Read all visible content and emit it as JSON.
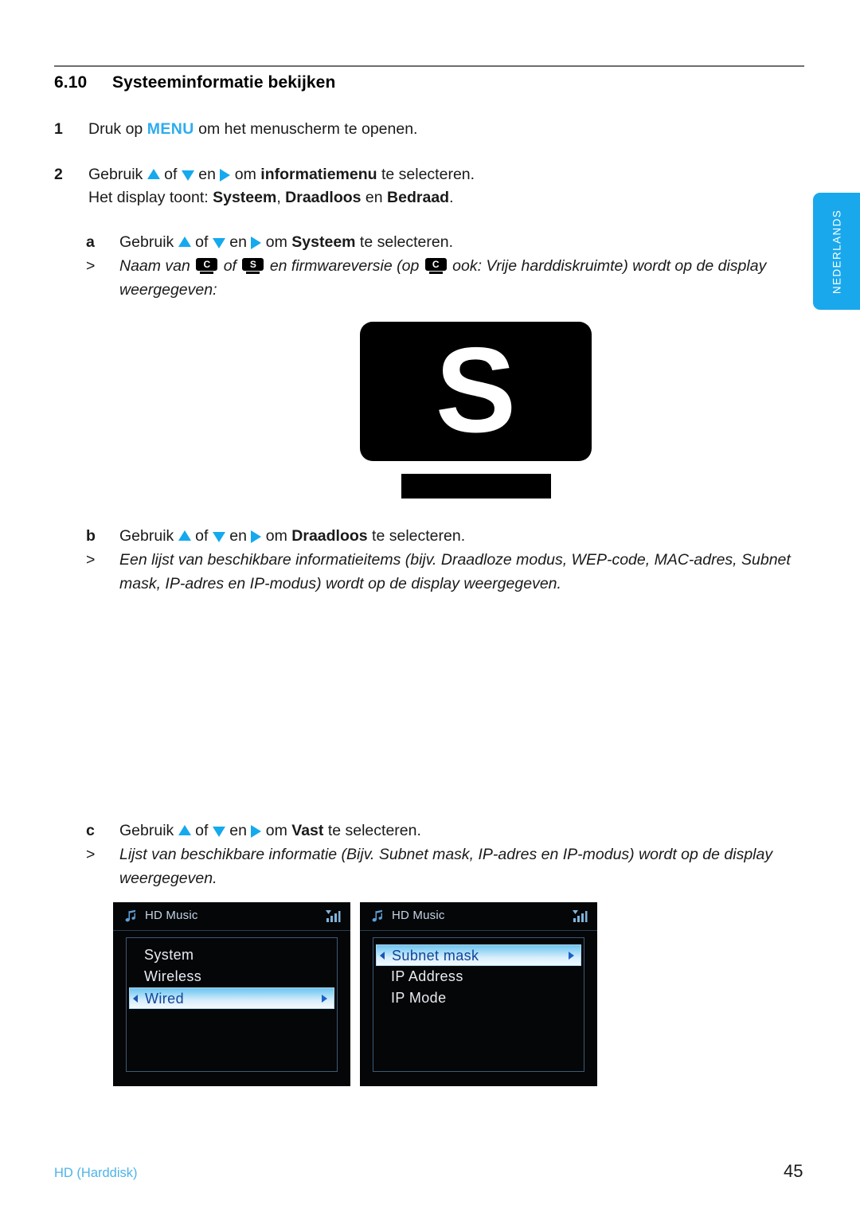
{
  "document": {
    "language_tab": "NEDERLANDS",
    "section_number": "6.10",
    "section_title": "Systeeminformatie bekijken",
    "footer_left": "HD (Harddisk)",
    "page_number": "45"
  },
  "colors": {
    "accent_blue": "#19A8EC",
    "keyword_blue": "#2CACEE",
    "triangle_blue": "#15A9EE",
    "footer_blue": "#4FB3E8",
    "lcd_background": "#050608",
    "lcd_highlight_text": "#12449A"
  },
  "steps": {
    "step1": {
      "marker": "1",
      "pre": "Druk op ",
      "keyword": "MENU",
      "post": " om het menuscherm te openen."
    },
    "step2": {
      "marker": "2",
      "line1_pre": "Gebruik ",
      "line1_of": " of ",
      "line1_en": " en ",
      "line1_om": " om ",
      "line1_bold": "informatiemenu",
      "line1_post": " te selecteren.",
      "line2_pre": "Het display toont: ",
      "line2_b1": "Systeem",
      "line2_sep1": ", ",
      "line2_b2": "Draadloos",
      "line2_sep2": " en ",
      "line2_b3": "Bedraad",
      "line2_post": "."
    },
    "sub_a": {
      "marker": "a",
      "pre": "Gebruik ",
      "of": " of ",
      "en": " en ",
      "om": " om ",
      "bold": "Systeem",
      "post": " te selecteren."
    },
    "note_a": {
      "gt": ">",
      "t1": "Naam van ",
      "badge1": "C",
      "t2": " of ",
      "badge2": "S",
      "t3": " en firmwareversie (op ",
      "badge3": "C",
      "t4": " ook: Vrije harddiskruimte) wordt op de display weergegeven:"
    },
    "sub_b": {
      "marker": "b",
      "pre": "Gebruik ",
      "of": " of ",
      "en": " en ",
      "om": " om ",
      "bold": "Draadloos",
      "post": " te selecteren."
    },
    "note_b": {
      "gt": ">",
      "text": "Een lijst van beschikbare informatieitems (bijv. Draadloze modus, WEP-code, MAC-adres, Subnet mask, IP-adres en IP-modus) wordt op de display weergegeven."
    },
    "sub_c": {
      "marker": "c",
      "pre": "Gebruik ",
      "of": " of ",
      "en": " en ",
      "om": " om ",
      "bold": "Vast",
      "post": " te selecteren."
    },
    "note_c": {
      "gt": ">",
      "text": "Lijst van beschikbare informatie (Bijv. Subnet mask, IP-adres en IP-modus) wordt op de display weergegeven."
    }
  },
  "figure_device": {
    "letter": "S"
  },
  "lcd_screens": [
    {
      "title": "HD Music",
      "rows": [
        {
          "label": "System",
          "selected": false
        },
        {
          "label": "Wireless",
          "selected": false
        },
        {
          "label": "Wired",
          "selected": true
        }
      ]
    },
    {
      "title": "HD Music",
      "rows": [
        {
          "label": "Subnet mask",
          "selected": true
        },
        {
          "label": "IP Address",
          "selected": false
        },
        {
          "label": "IP Mode",
          "selected": false
        }
      ]
    }
  ]
}
